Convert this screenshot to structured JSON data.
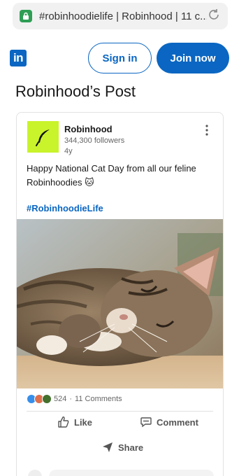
{
  "browser": {
    "url_text": "#robinhoodielife | Robinhood | 11 c..."
  },
  "header": {
    "logo_text": "in",
    "signin_label": "Sign in",
    "join_label": "Join now"
  },
  "page": {
    "title": "Robinhood’s Post"
  },
  "post": {
    "author": "Robinhood",
    "followers": "344,300 followers",
    "age": "4y",
    "text": "Happy National Cat Day from all our feline Robinhoodies 🐱",
    "hashtag": "#RobinhoodieLife",
    "reaction_count": "524",
    "separator": "·",
    "comments_count": "11 Comments",
    "actions": {
      "like": "Like",
      "comment": "Comment",
      "share": "Share"
    }
  },
  "colors": {
    "linkedin_blue": "#0a66c2",
    "robinhood_green": "#c9f32b",
    "lock_green": "#2e9e55"
  },
  "icons": [
    "lock-icon",
    "reload-icon",
    "feather-icon",
    "more-icon",
    "like-reaction-icon",
    "love-reaction-icon",
    "celebrate-reaction-icon",
    "thumbs-up-icon",
    "comment-icon",
    "share-icon"
  ]
}
